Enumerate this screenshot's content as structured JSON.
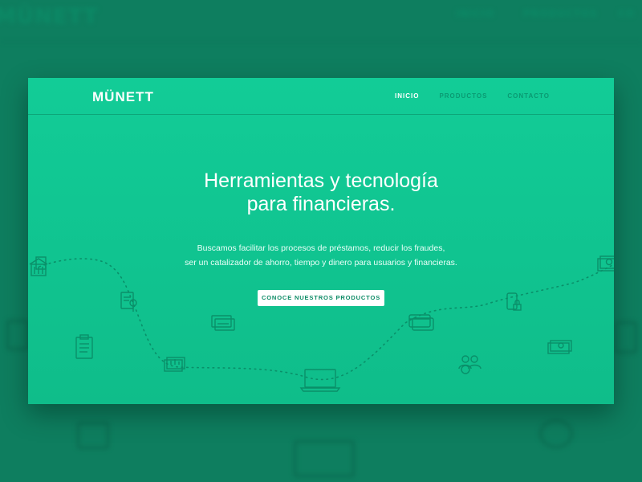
{
  "brand": {
    "logo": "MÜNETT"
  },
  "nav": {
    "items": [
      {
        "label": "INICIO",
        "active": true
      },
      {
        "label": "PRODUCTOS",
        "active": false
      },
      {
        "label": "CONTACTO",
        "active": false
      }
    ]
  },
  "hero": {
    "headline_line1": "Herramientas y tecnología",
    "headline_line2": "para financieras.",
    "sub_line1": "Buscamos facilitar los procesos de préstamos, reducir los fraudes,",
    "sub_line2": "ser un catalizador de ahorro, tiempo y dinero para usuarios y financieras.",
    "cta_label": "CONOCE NUESTROS PRODUCTOS"
  },
  "background": {
    "logo": "MÜNETT",
    "nav": [
      "INICIO",
      "PRODUCTOS",
      "CO"
    ]
  },
  "colors": {
    "page_bg": "#0e7e5f",
    "card_gradient_top": "#12cc97",
    "card_gradient_bottom": "#0fbd8a",
    "icon_stroke": "#0a8f69",
    "cta_text": "#0e8c66"
  },
  "icons": [
    "bank-icon",
    "document-search-icon",
    "clipboard-icon",
    "chart-box-icon",
    "cards-icon",
    "laptop-icon",
    "credit-cards-icon",
    "people-icon",
    "mobile-lock-icon",
    "cash-stack-icon",
    "money-box-icon"
  ]
}
